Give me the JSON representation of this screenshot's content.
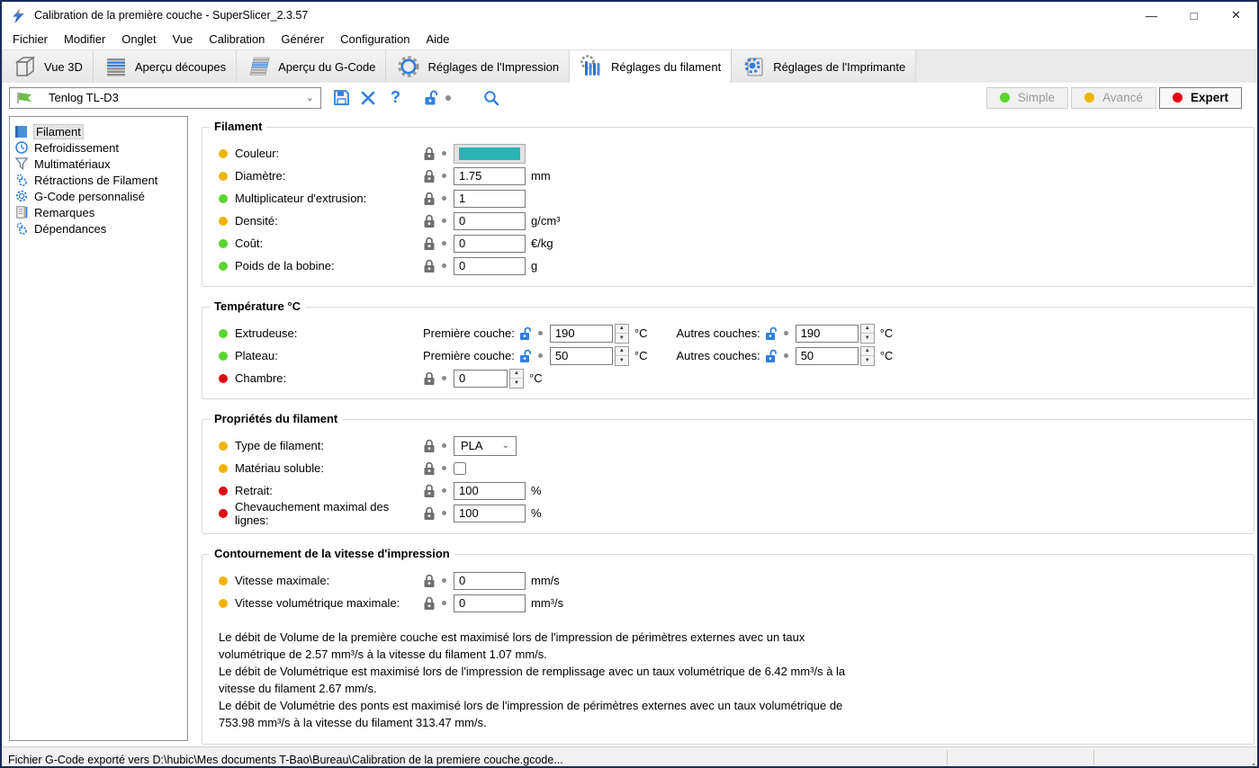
{
  "window": {
    "title": "Calibration de la première couche - SuperSlicer_2.3.57",
    "minimize_glyph": "—",
    "maximize_glyph": "□",
    "close_glyph": "✕"
  },
  "menu": [
    "Fichier",
    "Modifier",
    "Onglet",
    "Vue",
    "Calibration",
    "Générer",
    "Configuration",
    "Aide"
  ],
  "tabs": [
    {
      "label": "Vue 3D",
      "icon": "cube-icon",
      "active": false
    },
    {
      "label": "Aperçu découpes",
      "icon": "slices-icon",
      "active": false
    },
    {
      "label": "Aperçu du G-Code",
      "icon": "gcode-layers-icon",
      "active": false
    },
    {
      "label": "Réglages de l'Impression",
      "icon": "print-gear-icon",
      "active": false
    },
    {
      "label": "Réglages du filament",
      "icon": "filament-spool-icon",
      "active": true
    },
    {
      "label": "Réglages de l'Imprimante",
      "icon": "printer-gear-icon",
      "active": false
    }
  ],
  "toolbar": {
    "preset": "Tenlog TL-D3",
    "modes": [
      {
        "label": "Simple",
        "dot": "#5cd430",
        "active": false
      },
      {
        "label": "Avancé",
        "dot": "#f0b400",
        "active": false
      },
      {
        "label": "Expert",
        "dot": "#e30613",
        "active": true
      }
    ]
  },
  "sidebar": {
    "items": [
      {
        "label": "Filament",
        "selected": true
      },
      {
        "label": "Refroidissement",
        "selected": false
      },
      {
        "label": "Multimatériaux",
        "selected": false
      },
      {
        "label": "Rétractions de Filament",
        "selected": false
      },
      {
        "label": "G-Code personnalisé",
        "selected": false
      },
      {
        "label": "Remarques",
        "selected": false
      },
      {
        "label": "Dépendances",
        "selected": false
      }
    ]
  },
  "filament": {
    "title": "Filament",
    "rows": {
      "couleur": {
        "bullet": "#f0b400",
        "label": "Couleur:",
        "swatch": "#2ab5b5"
      },
      "diametre": {
        "bullet": "#f0b400",
        "label": "Diamètre:",
        "value": "1.75",
        "unit": "mm"
      },
      "multiplicateur": {
        "bullet": "#5cd430",
        "label": "Multiplicateur d'extrusion:",
        "value": "1"
      },
      "densite": {
        "bullet": "#f0b400",
        "label": "Densité:",
        "value": "0",
        "unit": "g/cm³"
      },
      "cout": {
        "bullet": "#5cd430",
        "label": "Coût:",
        "value": "0",
        "unit": "€/kg"
      },
      "poids": {
        "bullet": "#5cd430",
        "label": "Poids de la bobine:",
        "value": "0",
        "unit": "g"
      }
    }
  },
  "temperature": {
    "title": "Température °C",
    "first_layer_label": "Première couche:",
    "other_layers_label": "Autres couches:",
    "rows": {
      "extrudeuse": {
        "bullet": "#5cd430",
        "label": "Extrudeuse:",
        "first": "190",
        "other": "190",
        "unit": "°C"
      },
      "plateau": {
        "bullet": "#5cd430",
        "label": "Plateau:",
        "first": "50",
        "other": "50",
        "unit": "°C"
      },
      "chambre": {
        "bullet": "#e30613",
        "label": "Chambre:",
        "value": "0",
        "unit": "°C"
      }
    }
  },
  "proprietes": {
    "title": "Propriétés du filament",
    "rows": {
      "type": {
        "bullet": "#f0b400",
        "label": "Type de filament:",
        "value": "PLA"
      },
      "soluble": {
        "bullet": "#f0b400",
        "label": "Matériau soluble:"
      },
      "retrait": {
        "bullet": "#e30613",
        "label": "Retrait:",
        "value": "100",
        "unit": "%"
      },
      "chevauchement": {
        "bullet": "#e30613",
        "label": "Chevauchement maximal des lignes:",
        "value": "100",
        "unit": "%"
      }
    }
  },
  "contournement": {
    "title": "Contournement de la vitesse d'impression",
    "rows": {
      "vitesse_max": {
        "bullet": "#f0b400",
        "label": "Vitesse maximale:",
        "value": "0",
        "unit": "mm/s"
      },
      "vitesse_vol": {
        "bullet": "#f0b400",
        "label": "Vitesse volumétrique maximale:",
        "value": "0",
        "unit": "mm³/s"
      }
    },
    "info": [
      "Le débit de Volume de la première couche est maximisé lors de l'impression de périmètres externes avec un taux volumétrique de 2.57 mm³/s à la vitesse du filament 1.07 mm/s.",
      "Le débit de Volumétrique est maximisé lors de l'impression de remplissage avec un taux volumétrique de 6.42 mm³/s à la vitesse du filament 2.67 mm/s.",
      "Le débit de Volumétrie des ponts est maximisé lors de l'impression de périmètres externes avec un taux volumétrique de 753.98 mm³/s à la vitesse du filament 313.47 mm/s."
    ]
  },
  "statusbar": {
    "text": "Fichier G-Code exporté vers D:\\hubic\\Mes documents T-Bao\\Bureau\\Calibration de la premiere couche.gcode..."
  }
}
